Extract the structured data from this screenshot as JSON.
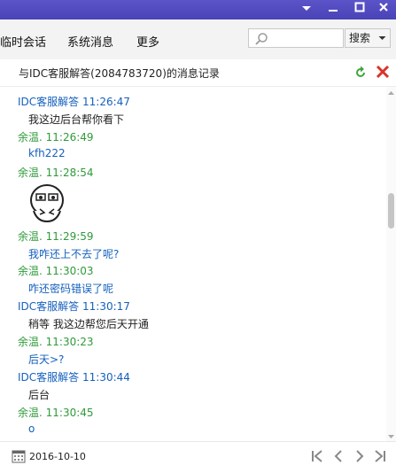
{
  "titlebar": {
    "controls": [
      "menu-dropdown",
      "minimize",
      "maximize",
      "close"
    ]
  },
  "tabs": [
    {
      "label": "临时会话"
    },
    {
      "label": "系统消息"
    },
    {
      "label": "更多"
    }
  ],
  "search": {
    "value": "",
    "placeholder": "",
    "button_label": "搜索"
  },
  "header": {
    "title": "与IDC客服解答(2084783720)的消息记录"
  },
  "colors": {
    "titlebar": "#4f48bf",
    "idc_sender": "#1560bd",
    "yu_sender": "#2f9a3a",
    "yu_text": "#1560bd"
  },
  "messages": [
    {
      "sender": "IDC客服解答",
      "time": "11:26:47",
      "text": "我这边后台帮你看下",
      "from": "idc"
    },
    {
      "sender": "余温.",
      "time": "11:26:49",
      "text": "kfh222",
      "from": "yu"
    },
    {
      "sender": "余温.",
      "time": "11:28:54",
      "sticker": "meme-face-icon",
      "from": "yu"
    },
    {
      "sender": "余温.",
      "time": "11:29:59",
      "text": "我咋还上不去了呢?",
      "from": "yu"
    },
    {
      "sender": "余温.",
      "time": "11:30:03",
      "text": "咋还密码错误了呢",
      "from": "yu"
    },
    {
      "sender": "IDC客服解答",
      "time": "11:30:17",
      "text": "稍等 我这边帮您后天开通",
      "from": "idc"
    },
    {
      "sender": "余温.",
      "time": "11:30:23",
      "text": "后天>?",
      "from": "yu"
    },
    {
      "sender": "IDC客服解答",
      "time": "11:30:44",
      "text": "后台",
      "from": "idc"
    },
    {
      "sender": "余温.",
      "time": "11:30:45",
      "text": "o",
      "from": "yu"
    }
  ],
  "footer": {
    "date": "2016-10-10",
    "nav": [
      "first-page-icon",
      "prev-page-icon",
      "next-page-icon",
      "last-page-icon"
    ]
  }
}
